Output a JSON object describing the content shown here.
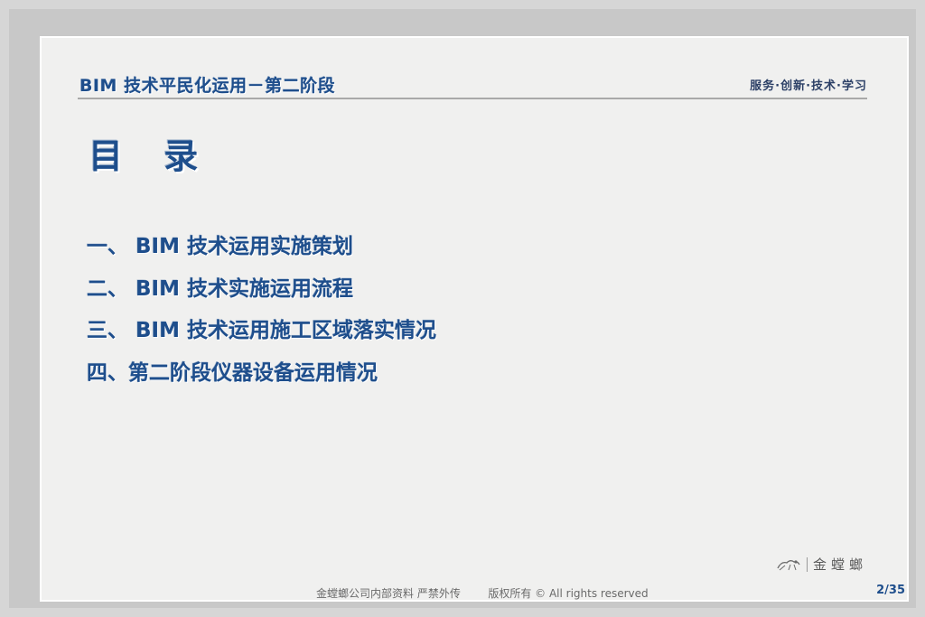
{
  "header": {
    "title": "BIM 技术平民化运用－第二阶段",
    "motto": "服务·创新·技术·学习"
  },
  "toc": {
    "title": "目 录",
    "items": [
      {
        "label": "一、 BIM 技术运用实施策划"
      },
      {
        "label": "二、 BIM 技术实施运用流程"
      },
      {
        "label": "三、 BIM 技术运用施工区域落实情况"
      },
      {
        "label": "四、第二阶段仪器设备运用情况"
      }
    ]
  },
  "logo": {
    "icon": "mantis-logo-icon",
    "text": "金螳螂"
  },
  "footer": {
    "text": "金螳螂公司内部资料 严禁外传        版权所有 © All rights reserved",
    "page": "2/35"
  },
  "colors": {
    "accent": "#1e4e8c",
    "slide_bg": "#f0f0ef",
    "frame_bg": "#c8c8c8"
  }
}
